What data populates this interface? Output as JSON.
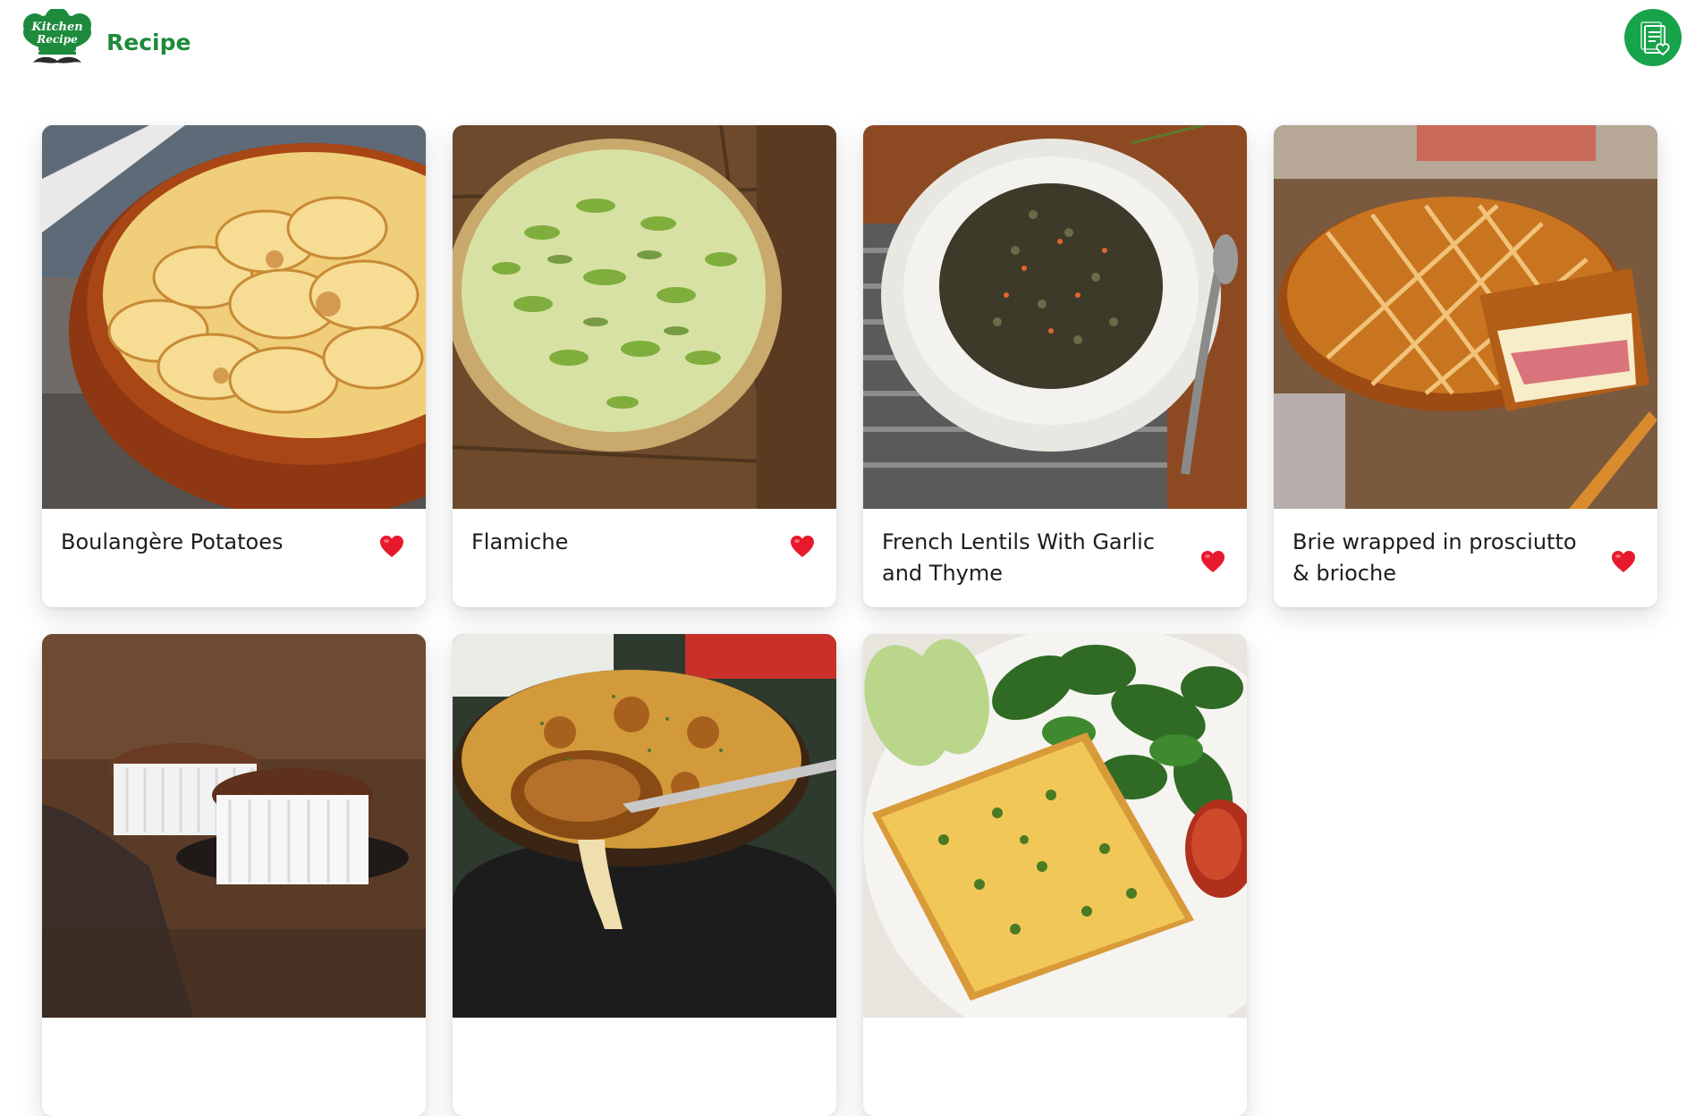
{
  "header": {
    "brand_title": "Recipe",
    "logo_text_line1": "Kitchen",
    "logo_text_line2": "Recipe",
    "logo_icon": "chef-hat-mustache-logo",
    "favorites_button_icon": "recipe-list-heart-icon"
  },
  "colors": {
    "brand_green": "#1d8a3c",
    "button_green": "#17a34a",
    "heart_red": "#e8192c"
  },
  "recipes": [
    {
      "title": "Boulangère Potatoes",
      "favorited": true,
      "image": "gratin-potatoes-in-terracotta-dish"
    },
    {
      "title": "Flamiche",
      "favorited": true,
      "image": "leek-tart-on-wooden-board"
    },
    {
      "title": "French Lentils With Garlic and Thyme",
      "favorited": true,
      "image": "lentils-in-white-bowl"
    },
    {
      "title": "Brie wrapped in prosciutto & brioche",
      "favorited": true,
      "image": "brioche-wrapped-brie"
    },
    {
      "title": "",
      "favorited": true,
      "image": "chocolate-souffles-in-ramekins"
    },
    {
      "title": "",
      "favorited": true,
      "image": "french-onion-soup-in-crock"
    },
    {
      "title": "",
      "favorited": true,
      "image": "frittata-with-spinach-and-avocado"
    }
  ]
}
